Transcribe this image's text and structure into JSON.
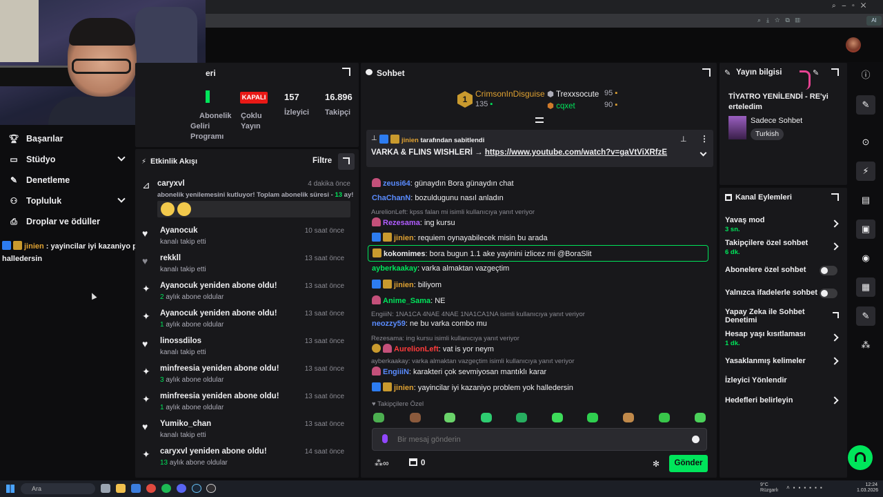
{
  "browser": {
    "ai_label": "AI"
  },
  "nav": {
    "items": [
      {
        "label": "Başarılar",
        "icon": "trophy-icon"
      },
      {
        "label": "Stüdyo",
        "icon": "studio-icon"
      },
      {
        "label": "Denetleme",
        "icon": "wrench-icon"
      },
      {
        "label": "Topluluk",
        "icon": "community-icon"
      },
      {
        "label": "Droplar ve ödüller",
        "icon": "gift-icon"
      }
    ],
    "overlay_user": "jinien",
    "overlay_text": " : yayincilar iyi kazaniyo problem yok halledersin"
  },
  "stats": {
    "panel_title_fragment": "eri",
    "status_badge": "KAPALI",
    "status_label_1": "Çoklu",
    "status_label_2": "Yayın",
    "left_label_1": "Abonelik",
    "left_label_2": "Geliri",
    "left_label_3": "Programı",
    "viewers": "157",
    "viewers_label": "İzleyici",
    "followers": "16.896",
    "followers_label": "Takipçi"
  },
  "activity": {
    "title": "Etkinlik Akışı",
    "filter_label": "Filtre",
    "first": {
      "user": "caryxvl",
      "time": "4 dakika önce",
      "message": "abonelik yenilemesini kutluyor! Toplam abonelik süresi - ",
      "months": "13",
      "months_suffix": " ay!"
    },
    "items": [
      {
        "user": "Ayanocuk",
        "sub": "kanalı takip etti",
        "time": "10 saat önce",
        "icon": "heart-icon"
      },
      {
        "user": "rekkll",
        "sub": "kanalı takip etti",
        "time": "13 saat önce",
        "icon": "heart-icon"
      },
      {
        "user": "Ayanocuk yeniden abone oldu!",
        "sub_num": "2",
        "sub": " aylık abone oldular",
        "time": "13 saat önce",
        "icon": "sparkle-icon"
      },
      {
        "user": "Ayanocuk yeniden abone oldu!",
        "sub_num": "1",
        "sub": " aylık abone oldular",
        "time": "13 saat önce",
        "icon": "sparkle-icon"
      },
      {
        "user": "linossdilos",
        "sub": "kanalı takip etti",
        "time": "13 saat önce",
        "icon": "heart-icon"
      },
      {
        "user": "minfreesia yeniden abone oldu!",
        "sub_num": "3",
        "sub": " aylık abone oldular",
        "time": "13 saat önce",
        "icon": "sparkle-icon"
      },
      {
        "user": "minfreesia yeniden abone oldu!",
        "sub_num": "1",
        "sub": " aylık abone oldular",
        "time": "13 saat önce",
        "icon": "sparkle-icon"
      },
      {
        "user": "Yumiko_chan",
        "sub": "kanalı takip etti",
        "time": "13 saat önce",
        "icon": "heart-icon"
      },
      {
        "user": "caryxvl yeniden abone oldu!",
        "sub_num": "13",
        "sub": " aylık abone oldular",
        "time": "14 saat önce",
        "icon": "sparkle-icon"
      }
    ]
  },
  "chat": {
    "title": "Sohbet",
    "leader1": {
      "name": "CrimsonInDisguise",
      "rank": "1",
      "score": "135"
    },
    "leader2": {
      "name": "Trexxsocute",
      "score": "95"
    },
    "leader3": {
      "name": "cqxet",
      "score": "90"
    },
    "pinned_by_user": "jinien",
    "pinned_by_text": "tarafından sabitlendi",
    "pinned_text": "VARKA & FLINS WISHLERİ → ",
    "pinned_link": "https://www.youtube.com/watch?v=gaVtViXRfzE",
    "messages": [
      {
        "user": "zeusi64",
        "color": "#5a8cff",
        "text": ": günaydın Bora günaydın chat"
      },
      {
        "user": "ChaChanN",
        "color": "#5a8cff",
        "text": ": bozuldugunu nasıl anladın"
      },
      {
        "reply": "AurelionLeft: kpss falan mi isimli kullanıcıya yanıt veriyor",
        "user": "Rezesama",
        "color": "#b15cff",
        "text": ": ing kursu"
      },
      {
        "user": "jinien",
        "color": "#e0a232",
        "text": ": requiem oynayabilecek misin bu arada"
      },
      {
        "user": "kokomimes",
        "color": "#efeff1",
        "text": ": bora bugun 1.1 ake yayinini izlicez mi @BoraSlit"
      },
      {
        "user": "ayberkaakay",
        "color": "#00e55b",
        "text": ": varka almaktan vazgeçtim"
      },
      {
        "user": "jinien",
        "color": "#e0a232",
        "text": ": biliyom"
      },
      {
        "user": "Anime_Sama",
        "color": "#00e55b",
        "text": ": NE"
      },
      {
        "reply": "EngiiiN: 1NA1CA 4NAE 4NAE 1NA1CA1NA isimli kullanıcıya yanıt veriyor",
        "user": "neozzy59",
        "color": "#5a8cff",
        "text": ": ne bu varka combo mu"
      },
      {
        "reply": "Rezesama: ing kursu isimli kullanıcıya yanıt veriyor",
        "user": "AurelionLeft",
        "color": "#ff3b3b",
        "text": ": vat is yor neym"
      },
      {
        "reply": "ayberkaakay: varka almaktan vazgeçtim isimli kullanıcıya yanıt veriyor",
        "user": "EngiiiN",
        "color": "#5a8cff",
        "text": ": karakteri çok sevmiyosan mantıklı karar"
      },
      {
        "user": "jinien",
        "color": "#e0a232",
        "text": ": yayincilar iyi kazaniyo problem yok halledersin"
      }
    ],
    "followers_only_label": "Takipçilere Özel",
    "input_placeholder": "Bir mesaj gönderin",
    "points": "0",
    "send_label": "Gönder"
  },
  "stream_info": {
    "title": "Yayın bilgisi",
    "stream_title": "TİYATRO YENİLENDİ - RE'yi erteledim",
    "category": "Sadece Sohbet",
    "tag": "Turkish"
  },
  "channel_actions": {
    "title": "Kanal Eylemleri",
    "items": [
      {
        "label": "Yavaş mod",
        "sub": "3 sn.",
        "control": "chevron"
      },
      {
        "label": "Takipçilere özel sohbet",
        "sub": "6 dk.",
        "control": "chevron"
      },
      {
        "label": "Abonelere özel sohbet",
        "control": "toggle"
      },
      {
        "label": "Yalnızca ifadelerle sohbet",
        "control": "toggle"
      },
      {
        "label": "Yapay Zeka ile Sohbet Denetimi",
        "control": "external"
      },
      {
        "label": "Hesap yaşı kısıtlaması",
        "sub": "1 dk.",
        "control": "chevron"
      },
      {
        "label": "Yasaklanmış kelimeler",
        "control": "chevron"
      },
      {
        "label": "İzleyici Yönlendir",
        "control": "none"
      },
      {
        "label": "Hedefleri belirleyin",
        "control": "chevron"
      }
    ]
  },
  "taskbar": {
    "search_placeholder": "Ara",
    "weather_temp": "9°C",
    "weather_text": "Rüzgarlı",
    "time": "12:24",
    "date": "1.03.2026"
  },
  "colors": {
    "accent": "#00e55b",
    "panel": "#18181b",
    "bg": "#0d0d0f",
    "badge_red": "#e91916"
  }
}
